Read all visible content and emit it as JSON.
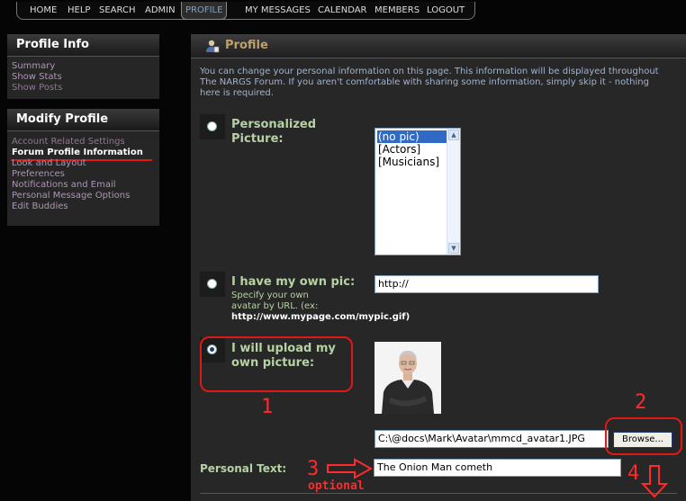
{
  "nav": {
    "items": [
      "HOME",
      "HELP",
      "SEARCH",
      "ADMIN",
      "PROFILE",
      "MY MESSAGES",
      "CALENDAR",
      "MEMBERS",
      "LOGOUT"
    ],
    "active": "PROFILE"
  },
  "sidebar": {
    "profile_info": {
      "title": "Profile Info",
      "links": [
        "Summary",
        "Show Stats",
        "Show Posts"
      ]
    },
    "modify_profile": {
      "title": "Modify Profile",
      "links": [
        "Account Related Settings",
        "Forum Profile Information",
        "Look and Layout Preferences",
        "Notifications and Email",
        "Personal Message Options",
        "Edit Buddies"
      ],
      "current": "Forum Profile Information"
    }
  },
  "main": {
    "title": "Profile",
    "intro": "You can change your personal information on this page. This information will be displayed throughout The NARGS Forum. If you aren't comfortable with sharing some information, simply skip it - nothing here is required.",
    "options": {
      "personalized": {
        "label": "Personalized Picture:",
        "selected": false
      },
      "own_pic": {
        "label": "I have my own pic:",
        "help": "Specify your own avatar by URL. (ex:",
        "example": "http://www.mypage.com/mypic.gif)",
        "url_value": "http://",
        "selected": false
      },
      "upload": {
        "label": "I will upload my own picture:",
        "selected": true,
        "file_value": "C:\\@docs\\Mark\\Avatar\\mmcd_avatar1.JPG",
        "browse_label": "Browse..."
      }
    },
    "picture_list": {
      "options": [
        "(no pic)",
        "[Actors]",
        "[Musicians]"
      ],
      "selected": "(no pic)"
    },
    "personal_text": {
      "label": "Personal Text:",
      "value": "The Onion Man cometh"
    }
  },
  "annotations": {
    "step1": "1",
    "step2": "2",
    "step3": "3",
    "step3_note": "optional",
    "step4": "4",
    "color": "#ff2a2a"
  }
}
